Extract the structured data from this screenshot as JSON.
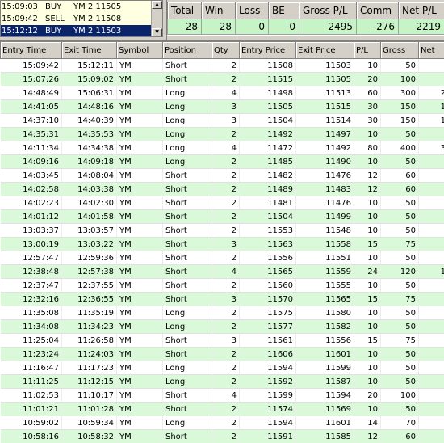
{
  "order_log": {
    "rows": [
      {
        "time": "15:09:03",
        "side": "BUY",
        "symbol": "YM 2 11505",
        "selected": false
      },
      {
        "time": "15:09:42",
        "side": "SELL",
        "symbol": "YM 2 11508",
        "selected": false
      },
      {
        "time": "15:12:12",
        "side": "BUY",
        "symbol": "YM 2 11503",
        "selected": true
      }
    ]
  },
  "summary": {
    "headers": [
      "Total",
      "Win",
      "Loss",
      "BE",
      "Gross P/L",
      "Comm",
      "Net P/L"
    ],
    "values": [
      "28",
      "28",
      "0",
      "0",
      "2495",
      "-276",
      "2219"
    ]
  },
  "trades": {
    "headers": [
      "Entry Time",
      "Exit Time",
      "Symbol",
      "Position",
      "Qty",
      "Entry Price",
      "Exit Price",
      "P/L",
      "Gross",
      "Net"
    ],
    "rows": [
      [
        "15:09:42",
        "15:12:11",
        "YM",
        "Short",
        "2",
        "11508",
        "11503",
        "10",
        "50",
        ""
      ],
      [
        "15:07:26",
        "15:09:02",
        "YM",
        "Short",
        "2",
        "11515",
        "11505",
        "20",
        "100",
        ""
      ],
      [
        "14:48:49",
        "15:06:31",
        "YM",
        "Long",
        "4",
        "11498",
        "11513",
        "60",
        "300",
        "2"
      ],
      [
        "14:41:05",
        "14:48:16",
        "YM",
        "Long",
        "3",
        "11505",
        "11515",
        "30",
        "150",
        "1"
      ],
      [
        "14:37:10",
        "14:40:39",
        "YM",
        "Long",
        "3",
        "11504",
        "11514",
        "30",
        "150",
        "1"
      ],
      [
        "14:35:31",
        "14:35:53",
        "YM",
        "Long",
        "2",
        "11492",
        "11497",
        "10",
        "50",
        ""
      ],
      [
        "14:11:34",
        "14:34:38",
        "YM",
        "Long",
        "4",
        "11472",
        "11492",
        "80",
        "400",
        "3"
      ],
      [
        "14:09:16",
        "14:09:18",
        "YM",
        "Long",
        "2",
        "11485",
        "11490",
        "10",
        "50",
        ""
      ],
      [
        "14:03:45",
        "14:08:04",
        "YM",
        "Short",
        "2",
        "11482",
        "11476",
        "12",
        "60",
        ""
      ],
      [
        "14:02:58",
        "14:03:38",
        "YM",
        "Short",
        "2",
        "11489",
        "11483",
        "12",
        "60",
        ""
      ],
      [
        "14:02:23",
        "14:02:30",
        "YM",
        "Short",
        "2",
        "11481",
        "11476",
        "10",
        "50",
        ""
      ],
      [
        "14:01:12",
        "14:01:58",
        "YM",
        "Short",
        "2",
        "11504",
        "11499",
        "10",
        "50",
        ""
      ],
      [
        "13:03:37",
        "13:03:57",
        "YM",
        "Short",
        "2",
        "11553",
        "11548",
        "10",
        "50",
        ""
      ],
      [
        "13:00:19",
        "13:03:22",
        "YM",
        "Short",
        "3",
        "11563",
        "11558",
        "15",
        "75",
        ""
      ],
      [
        "12:57:47",
        "12:59:36",
        "YM",
        "Short",
        "2",
        "11556",
        "11551",
        "10",
        "50",
        ""
      ],
      [
        "12:38:48",
        "12:57:38",
        "YM",
        "Short",
        "4",
        "11565",
        "11559",
        "24",
        "120",
        "1"
      ],
      [
        "12:37:47",
        "12:37:55",
        "YM",
        "Short",
        "2",
        "11560",
        "11555",
        "10",
        "50",
        ""
      ],
      [
        "12:32:16",
        "12:36:55",
        "YM",
        "Short",
        "3",
        "11570",
        "11565",
        "15",
        "75",
        ""
      ],
      [
        "11:35:08",
        "11:35:19",
        "YM",
        "Long",
        "2",
        "11575",
        "11580",
        "10",
        "50",
        ""
      ],
      [
        "11:34:08",
        "11:34:23",
        "YM",
        "Long",
        "2",
        "11577",
        "11582",
        "10",
        "50",
        ""
      ],
      [
        "11:25:04",
        "11:26:58",
        "YM",
        "Short",
        "3",
        "11561",
        "11556",
        "15",
        "75",
        ""
      ],
      [
        "11:23:24",
        "11:24:03",
        "YM",
        "Short",
        "2",
        "11606",
        "11601",
        "10",
        "50",
        ""
      ],
      [
        "11:16:47",
        "11:17:23",
        "YM",
        "Long",
        "2",
        "11594",
        "11599",
        "10",
        "50",
        ""
      ],
      [
        "11:11:25",
        "11:12:15",
        "YM",
        "Long",
        "2",
        "11592",
        "11587",
        "10",
        "50",
        ""
      ],
      [
        "11:02:53",
        "11:10:17",
        "YM",
        "Short",
        "4",
        "11599",
        "11594",
        "20",
        "100",
        ""
      ],
      [
        "11:01:21",
        "11:01:28",
        "YM",
        "Short",
        "2",
        "11574",
        "11569",
        "10",
        "50",
        ""
      ],
      [
        "10:59:02",
        "10:59:34",
        "YM",
        "Long",
        "2",
        "11594",
        "11601",
        "14",
        "70",
        ""
      ],
      [
        "10:58:16",
        "10:58:32",
        "YM",
        "Short",
        "2",
        "11591",
        "11585",
        "12",
        "60",
        ""
      ]
    ]
  }
}
